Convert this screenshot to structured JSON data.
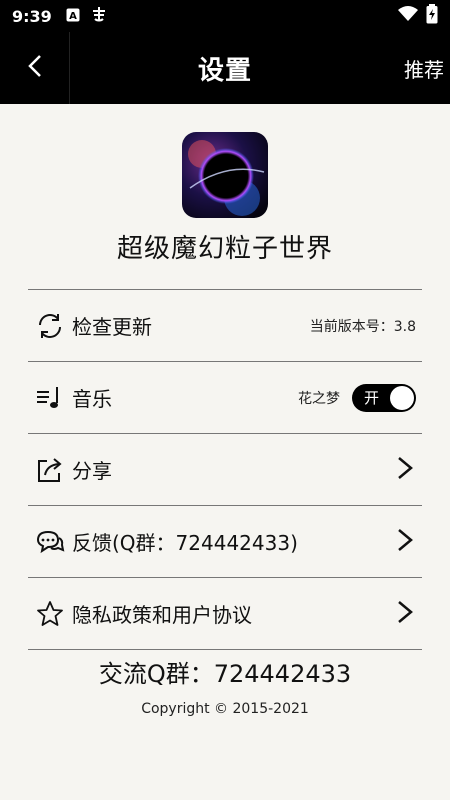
{
  "status": {
    "time": "9:39"
  },
  "appbar": {
    "title": "设置",
    "action": "推荐"
  },
  "app": {
    "name": "超级魔幻粒子世界"
  },
  "rows": [
    {
      "label": "检查更新",
      "right_text": "当前版本号：3.8",
      "icon": "refresh-icon"
    },
    {
      "label": "音乐",
      "right_text": "花之梦",
      "icon": "music-list-icon",
      "toggle": "开"
    },
    {
      "label": "分享",
      "icon": "share-icon"
    },
    {
      "label": "反馈(Q群：724442433)",
      "icon": "chat-bubbles-icon"
    },
    {
      "label": "隐私政策和用户协议",
      "icon": "star-icon"
    }
  ],
  "footer": {
    "qq_group": "交流Q群：724442433",
    "copyright": "Copyright © 2015-2021"
  }
}
